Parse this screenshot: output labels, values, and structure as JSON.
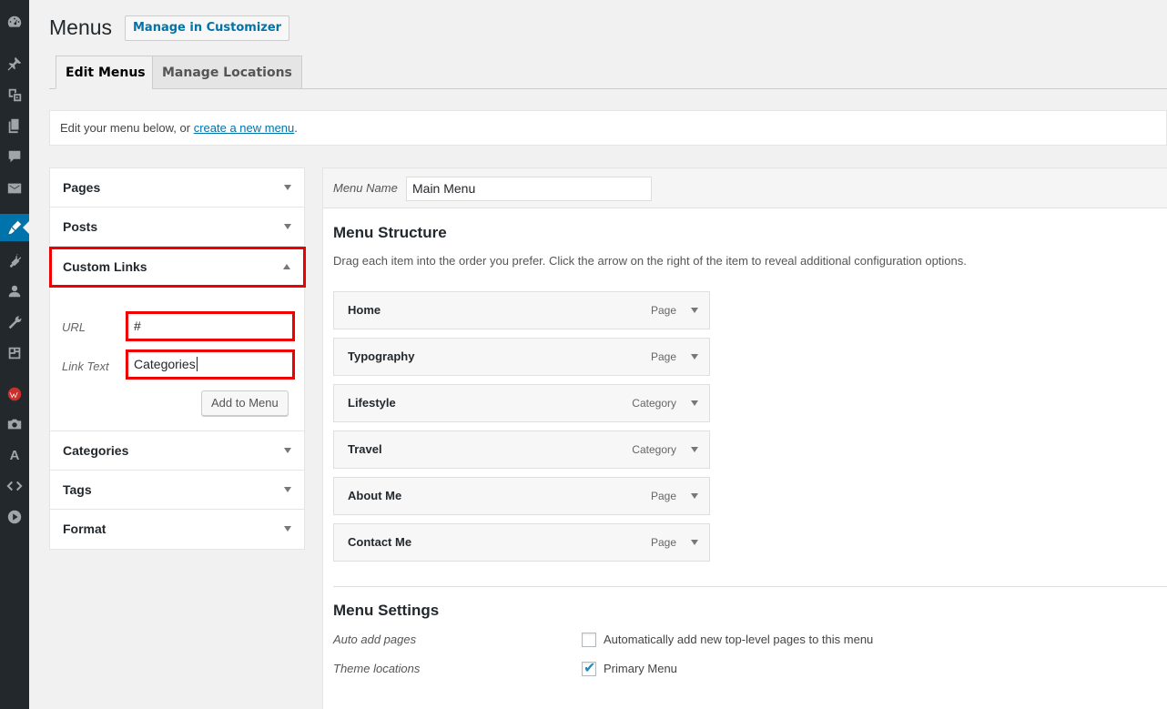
{
  "header": {
    "title": "Menus",
    "customizer_button": "Manage in Customizer"
  },
  "tabs": [
    {
      "label": "Edit Menus",
      "active": true
    },
    {
      "label": "Manage Locations",
      "active": false
    }
  ],
  "notice": {
    "prefix": "Edit your menu below, or ",
    "link": "create a new menu",
    "suffix": "."
  },
  "sidebar": {
    "icons": [
      "dashboard-icon",
      "pin-icon",
      "media-icon",
      "pages-icon",
      "comments-icon",
      "mail-icon",
      "appearance-icon",
      "plugins-icon",
      "users-icon",
      "tools-icon",
      "settings-icon",
      "plugin-logo-icon",
      "camera-icon",
      "font-icon",
      "code-icon",
      "play-icon"
    ],
    "active": "appearance-icon",
    "font_letter": "A"
  },
  "accordion": {
    "items": [
      {
        "label": "Pages"
      },
      {
        "label": "Posts"
      },
      {
        "label": "Custom Links",
        "open": true
      },
      {
        "label": "Categories"
      },
      {
        "label": "Tags"
      },
      {
        "label": "Format"
      }
    ],
    "custom_links": {
      "url_label": "URL",
      "url_value": "#",
      "link_text_label": "Link Text",
      "link_text_value": "Categories",
      "add_button": "Add to Menu"
    }
  },
  "menu": {
    "name_label": "Menu Name",
    "name_value": "Main Menu",
    "structure_title": "Menu Structure",
    "structure_desc": "Drag each item into the order you prefer. Click the arrow on the right of the item to reveal additional configuration options.",
    "items": [
      {
        "title": "Home",
        "type": "Page"
      },
      {
        "title": "Typography",
        "type": "Page"
      },
      {
        "title": "Lifestyle",
        "type": "Category"
      },
      {
        "title": "Travel",
        "type": "Category"
      },
      {
        "title": "About Me",
        "type": "Page"
      },
      {
        "title": "Contact Me",
        "type": "Page"
      }
    ],
    "settings_title": "Menu Settings",
    "auto_add_label": "Auto add pages",
    "auto_add_text": "Automatically add new top-level pages to this menu",
    "auto_add_checked": false,
    "theme_locations_label": "Theme locations",
    "primary_menu_text": "Primary Menu",
    "primary_menu_checked": true
  }
}
